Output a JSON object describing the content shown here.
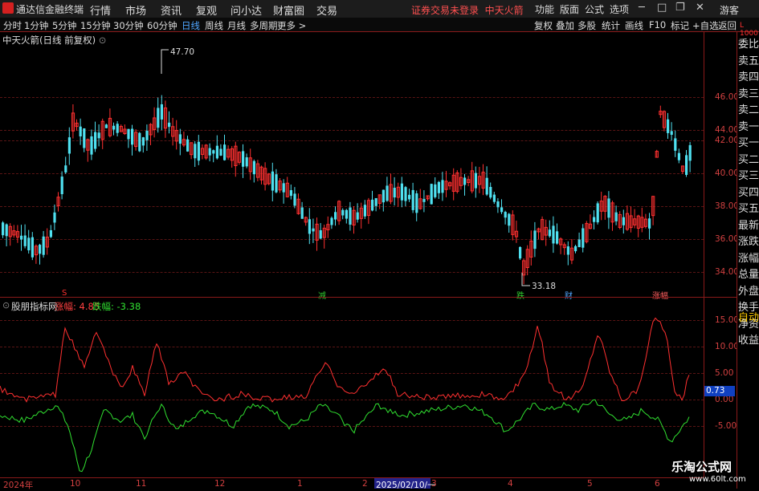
{
  "app": {
    "name": "通达信金融终端",
    "notice": "证券交易未登录",
    "stock_name_top": "中天火箭",
    "guest_label": "游客"
  },
  "menu": [
    "行情",
    "市场",
    "资讯",
    "复观",
    "问小达",
    "财富圈",
    "交易"
  ],
  "right_menu": [
    "功能",
    "版面",
    "公式",
    "选项"
  ],
  "periods": [
    "分时",
    "1分钟",
    "5分钟",
    "15分钟",
    "30分钟",
    "60分钟",
    "日线",
    "周线",
    "月线",
    "多周期",
    "更多 >"
  ],
  "active_period": "日线",
  "tools": [
    "复权",
    "叠加",
    "多股",
    "统计",
    "画线",
    "F10",
    "标记",
    "+自选",
    "返回"
  ],
  "chart": {
    "title": "中天火箭(日线 前复权)",
    "high_label": "47.70",
    "low_label": "33.18",
    "price_axis": [
      "46.00",
      "44.00",
      "42.00",
      "40.00",
      "38.00",
      "36.00",
      "34.00"
    ],
    "markers": [
      {
        "text": "S",
        "color": "#ff3030"
      },
      {
        "text": "减",
        "color": "#30d030"
      },
      {
        "text": "跌",
        "color": "#30d030"
      },
      {
        "text": "财",
        "color": "#4fa6ff"
      },
      {
        "text": "涨幅",
        "color": "#ff6060"
      }
    ]
  },
  "indicator": {
    "title": "股朋指标网",
    "up_label": "涨幅: 4.85",
    "down_label": "跌幅: -3.38",
    "axis": [
      "15.00",
      "10.00",
      "5.00",
      "0.00",
      "-5.00"
    ],
    "current_value": "0.73"
  },
  "side_panel": [
    "委比",
    "卖五",
    "卖四",
    "卖三",
    "卖二",
    "卖一",
    "买一",
    "买二",
    "买三",
    "买四",
    "买五",
    "最新",
    "涨跌",
    "涨幅",
    "总量",
    "外盘",
    "换手",
    "净资",
    "收益",
    "自动"
  ],
  "side_top_label": "L 1000",
  "dates": [
    "2024年",
    "10",
    "11",
    "12",
    "1",
    "2",
    "2025/02/10/一",
    "3",
    "4",
    "5",
    "6"
  ],
  "watermark": {
    "line1": "乐淘公式网",
    "line2": "www.60lt.com"
  },
  "colors": {
    "up": "#ff3030",
    "down": "#4fe0f0",
    "grid": "#5a1414",
    "axis": "#d24040",
    "ind_up": "#ff3030",
    "ind_down": "#30e030"
  }
}
